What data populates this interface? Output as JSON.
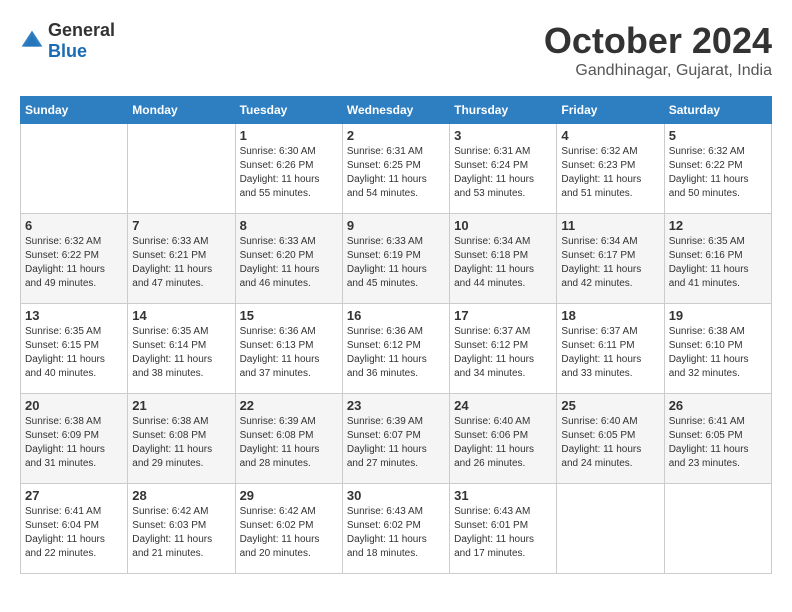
{
  "logo": {
    "general": "General",
    "blue": "Blue"
  },
  "header": {
    "month": "October 2024",
    "location": "Gandhinagar, Gujarat, India"
  },
  "weekdays": [
    "Sunday",
    "Monday",
    "Tuesday",
    "Wednesday",
    "Thursday",
    "Friday",
    "Saturday"
  ],
  "weeks": [
    [
      {
        "day": "",
        "info": ""
      },
      {
        "day": "",
        "info": ""
      },
      {
        "day": "1",
        "info": "Sunrise: 6:30 AM\nSunset: 6:26 PM\nDaylight: 11 hours\nand 55 minutes."
      },
      {
        "day": "2",
        "info": "Sunrise: 6:31 AM\nSunset: 6:25 PM\nDaylight: 11 hours\nand 54 minutes."
      },
      {
        "day": "3",
        "info": "Sunrise: 6:31 AM\nSunset: 6:24 PM\nDaylight: 11 hours\nand 53 minutes."
      },
      {
        "day": "4",
        "info": "Sunrise: 6:32 AM\nSunset: 6:23 PM\nDaylight: 11 hours\nand 51 minutes."
      },
      {
        "day": "5",
        "info": "Sunrise: 6:32 AM\nSunset: 6:22 PM\nDaylight: 11 hours\nand 50 minutes."
      }
    ],
    [
      {
        "day": "6",
        "info": "Sunrise: 6:32 AM\nSunset: 6:22 PM\nDaylight: 11 hours\nand 49 minutes."
      },
      {
        "day": "7",
        "info": "Sunrise: 6:33 AM\nSunset: 6:21 PM\nDaylight: 11 hours\nand 47 minutes."
      },
      {
        "day": "8",
        "info": "Sunrise: 6:33 AM\nSunset: 6:20 PM\nDaylight: 11 hours\nand 46 minutes."
      },
      {
        "day": "9",
        "info": "Sunrise: 6:33 AM\nSunset: 6:19 PM\nDaylight: 11 hours\nand 45 minutes."
      },
      {
        "day": "10",
        "info": "Sunrise: 6:34 AM\nSunset: 6:18 PM\nDaylight: 11 hours\nand 44 minutes."
      },
      {
        "day": "11",
        "info": "Sunrise: 6:34 AM\nSunset: 6:17 PM\nDaylight: 11 hours\nand 42 minutes."
      },
      {
        "day": "12",
        "info": "Sunrise: 6:35 AM\nSunset: 6:16 PM\nDaylight: 11 hours\nand 41 minutes."
      }
    ],
    [
      {
        "day": "13",
        "info": "Sunrise: 6:35 AM\nSunset: 6:15 PM\nDaylight: 11 hours\nand 40 minutes."
      },
      {
        "day": "14",
        "info": "Sunrise: 6:35 AM\nSunset: 6:14 PM\nDaylight: 11 hours\nand 38 minutes."
      },
      {
        "day": "15",
        "info": "Sunrise: 6:36 AM\nSunset: 6:13 PM\nDaylight: 11 hours\nand 37 minutes."
      },
      {
        "day": "16",
        "info": "Sunrise: 6:36 AM\nSunset: 6:12 PM\nDaylight: 11 hours\nand 36 minutes."
      },
      {
        "day": "17",
        "info": "Sunrise: 6:37 AM\nSunset: 6:12 PM\nDaylight: 11 hours\nand 34 minutes."
      },
      {
        "day": "18",
        "info": "Sunrise: 6:37 AM\nSunset: 6:11 PM\nDaylight: 11 hours\nand 33 minutes."
      },
      {
        "day": "19",
        "info": "Sunrise: 6:38 AM\nSunset: 6:10 PM\nDaylight: 11 hours\nand 32 minutes."
      }
    ],
    [
      {
        "day": "20",
        "info": "Sunrise: 6:38 AM\nSunset: 6:09 PM\nDaylight: 11 hours\nand 31 minutes."
      },
      {
        "day": "21",
        "info": "Sunrise: 6:38 AM\nSunset: 6:08 PM\nDaylight: 11 hours\nand 29 minutes."
      },
      {
        "day": "22",
        "info": "Sunrise: 6:39 AM\nSunset: 6:08 PM\nDaylight: 11 hours\nand 28 minutes."
      },
      {
        "day": "23",
        "info": "Sunrise: 6:39 AM\nSunset: 6:07 PM\nDaylight: 11 hours\nand 27 minutes."
      },
      {
        "day": "24",
        "info": "Sunrise: 6:40 AM\nSunset: 6:06 PM\nDaylight: 11 hours\nand 26 minutes."
      },
      {
        "day": "25",
        "info": "Sunrise: 6:40 AM\nSunset: 6:05 PM\nDaylight: 11 hours\nand 24 minutes."
      },
      {
        "day": "26",
        "info": "Sunrise: 6:41 AM\nSunset: 6:05 PM\nDaylight: 11 hours\nand 23 minutes."
      }
    ],
    [
      {
        "day": "27",
        "info": "Sunrise: 6:41 AM\nSunset: 6:04 PM\nDaylight: 11 hours\nand 22 minutes."
      },
      {
        "day": "28",
        "info": "Sunrise: 6:42 AM\nSunset: 6:03 PM\nDaylight: 11 hours\nand 21 minutes."
      },
      {
        "day": "29",
        "info": "Sunrise: 6:42 AM\nSunset: 6:02 PM\nDaylight: 11 hours\nand 20 minutes."
      },
      {
        "day": "30",
        "info": "Sunrise: 6:43 AM\nSunset: 6:02 PM\nDaylight: 11 hours\nand 18 minutes."
      },
      {
        "day": "31",
        "info": "Sunrise: 6:43 AM\nSunset: 6:01 PM\nDaylight: 11 hours\nand 17 minutes."
      },
      {
        "day": "",
        "info": ""
      },
      {
        "day": "",
        "info": ""
      }
    ]
  ]
}
